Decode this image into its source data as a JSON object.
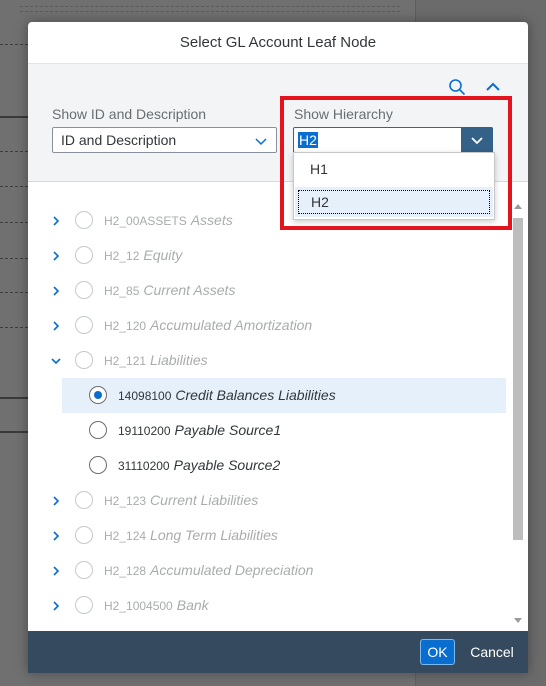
{
  "dialog": {
    "title": "Select GL Account Leaf Node"
  },
  "filter": {
    "id_label": "Show ID and Description",
    "id_value": "ID and Description",
    "hierarchy_label": "Show Hierarchy",
    "hierarchy_value": "H2",
    "hierarchy_options": [
      "H1",
      "H2"
    ]
  },
  "tree": [
    {
      "id": "H2_00ASSETS",
      "desc": "Assets",
      "expander": "right",
      "leaf": false
    },
    {
      "id": "H2_12",
      "desc": "Equity",
      "expander": "right",
      "leaf": false
    },
    {
      "id": "H2_85",
      "desc": "Current Assets",
      "expander": "right",
      "leaf": false
    },
    {
      "id": "H2_120",
      "desc": "Accumulated Amortization",
      "expander": "right",
      "leaf": false
    },
    {
      "id": "H2_121",
      "desc": "Liabilities",
      "expander": "down",
      "leaf": false
    },
    {
      "id": "14098100",
      "desc": "Credit Balances Liabilities",
      "expander": "none",
      "leaf": true,
      "selected": true
    },
    {
      "id": "19110200",
      "desc": "Payable Source1",
      "expander": "none",
      "leaf": true
    },
    {
      "id": "31110200",
      "desc": "Payable Source2",
      "expander": "none",
      "leaf": true
    },
    {
      "id": "H2_123",
      "desc": "Current Liabilities",
      "expander": "right",
      "leaf": false
    },
    {
      "id": "H2_124",
      "desc": "Long Term Liabilities",
      "expander": "right",
      "leaf": false
    },
    {
      "id": "H2_128",
      "desc": "Accumulated Depreciation",
      "expander": "right",
      "leaf": false
    },
    {
      "id": "H2_1004500",
      "desc": "Bank",
      "expander": "right",
      "leaf": false
    }
  ],
  "footer": {
    "ok_label": "OK",
    "cancel_label": "Cancel"
  },
  "colors": {
    "accent": "#0a6ed1",
    "highlight": "#e4141e",
    "footer": "#354a5f"
  }
}
